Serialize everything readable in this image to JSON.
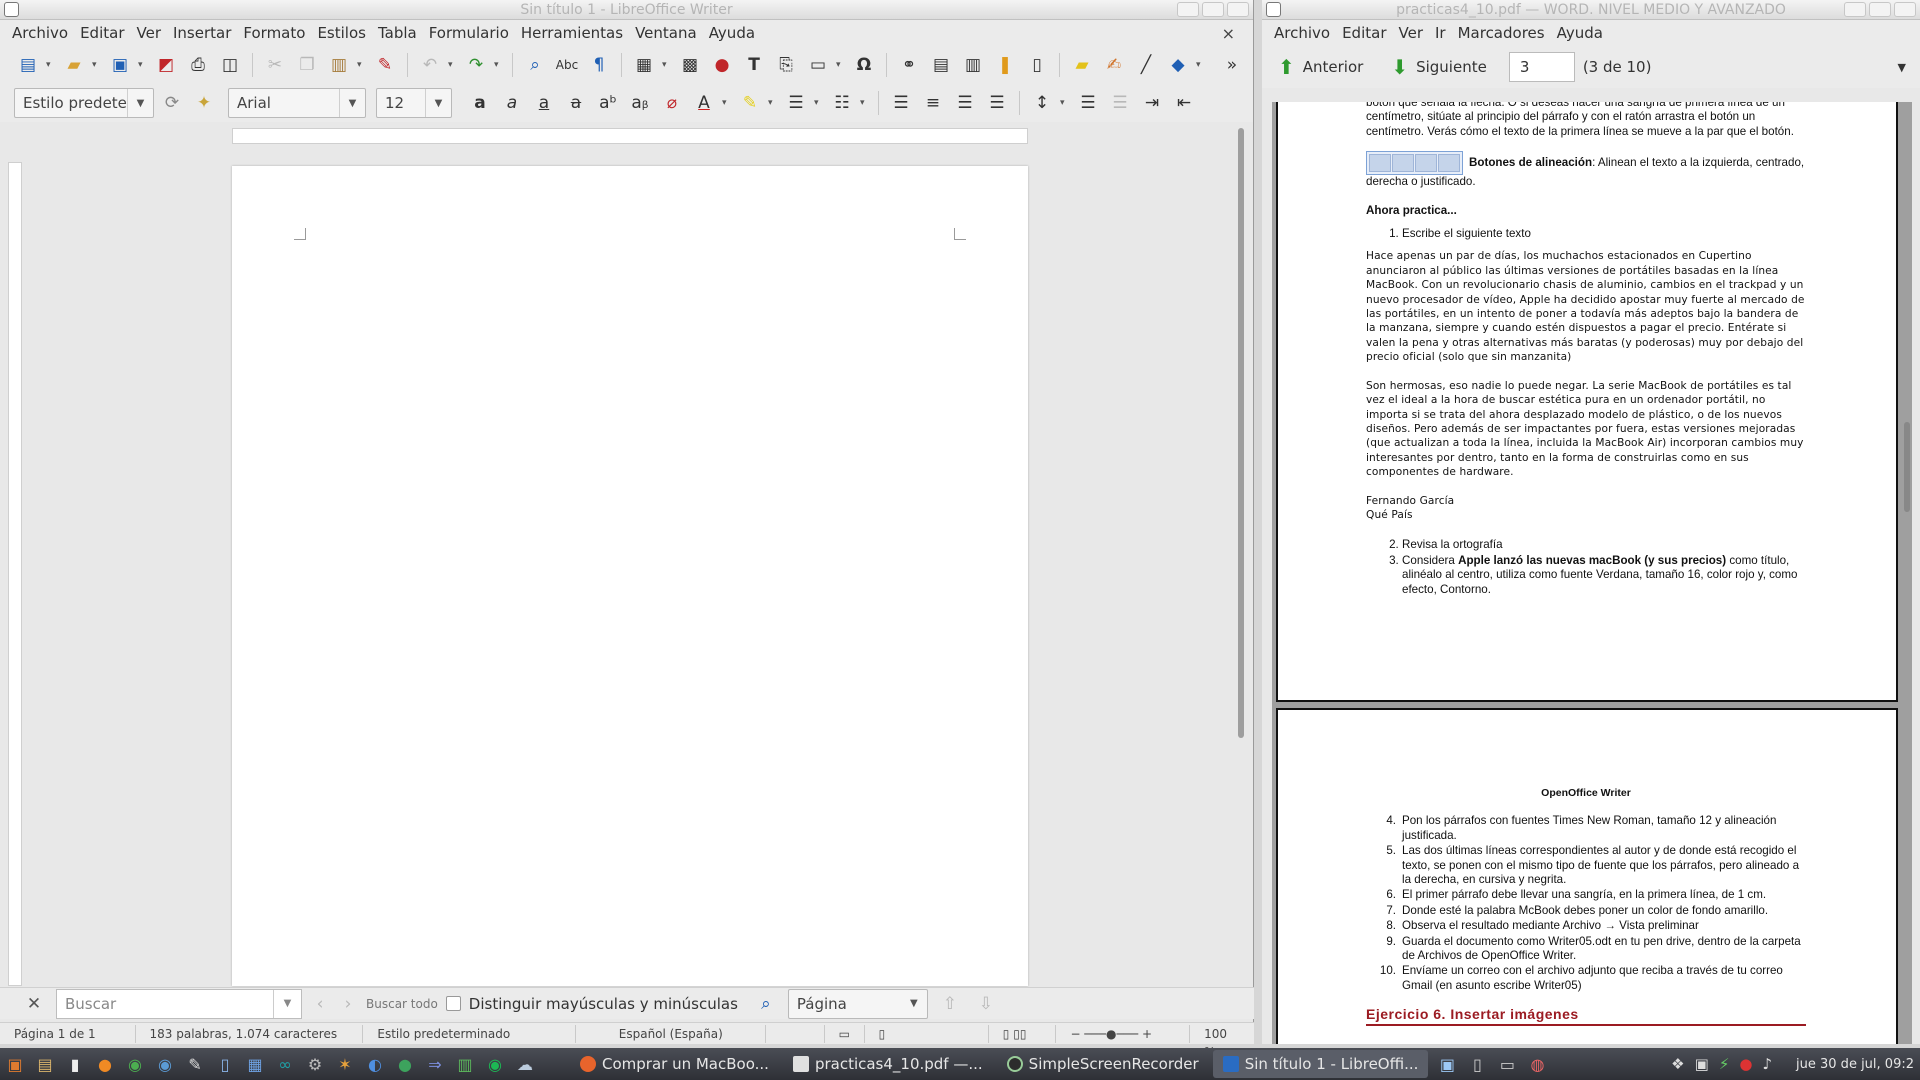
{
  "libreoffice": {
    "title": "Sin título 1 - LibreOffice Writer",
    "menu": [
      "Archivo",
      "Editar",
      "Ver",
      "Insertar",
      "Formato",
      "Estilos",
      "Tabla",
      "Formulario",
      "Herramientas",
      "Ventana",
      "Ayuda"
    ],
    "close_glyph": "×",
    "style_value": "Estilo predete",
    "font_value": "Arial",
    "size_value": "12",
    "find": {
      "placeholder": "Buscar",
      "find_all": "Buscar todo",
      "match_case": "Distinguir mayúsculas y minúsculas",
      "scope": "Página"
    },
    "status": {
      "page": "Página 1 de 1",
      "words": "183 palabras, 1.074 caracteres",
      "style": "Estilo predeterminado",
      "language": "Español (España)",
      "zoom": "100 %"
    }
  },
  "pdf": {
    "title": "practicas4_10.pdf — WORD. NIVEL MEDIO Y AVANZADO",
    "menu": [
      "Archivo",
      "Editar",
      "Ver",
      "Ir",
      "Marcadores",
      "Ayuda"
    ],
    "prev_label": "Anterior",
    "next_label": "Siguiente",
    "page_value": "3",
    "page_count": "(3 de 10)",
    "top_text": "botón que señala la flecha. O si deseas hacer una sangría de primera línea de un centímetro, sitúate al principio del párrafo y con el ratón arrastra el botón un centímetro. Verás cómo el texto de la primera línea se mueve a la par que el botón.",
    "align_label": "Botones de alineación",
    "align_text": ": Alinean el texto a la izquierda, centrado, derecha o justificado.",
    "practice_heading": "Ahora practica...",
    "step1": "Escribe el siguiente texto",
    "para1": "Hace apenas un par de días, los muchachos estacionados en Cupertino anunciaron al público las últimas versiones de portátiles basadas en la línea MacBook. Con un revolucionario chasis de aluminio, cambios en el trackpad y un nuevo procesador de vídeo, Apple ha decidido apostar muy fuerte al mercado de las portátiles, en un intento de poner a todavía más adeptos bajo la bandera de la manzana, siempre y cuando estén dispuestos a pagar el precio. Entérate si valen la pena y otras alternativas más baratas (y poderosas) muy por debajo del precio oficial (solo que sin manzanita)",
    "para2": "Son hermosas, eso nadie lo puede negar. La serie MacBook de portátiles es tal vez el ideal a la hora de buscar estética pura en un ordenador portátil, no importa si se trata del ahora desplazado modelo de plástico, o de los nuevos diseños. Pero además de ser impactantes por fuera, estas versiones mejoradas (que actualizan a toda la línea, incluida la MacBook Air) incorporan cambios muy interesantes por dentro, tanto en la forma de construirlas como en sus componentes de hardware.",
    "author": "Fernando García",
    "source": "Qué País",
    "step2": "Revisa la ortografía",
    "step3_pre": "Considera ",
    "step3_bold": "Apple lanzó las nuevas macBook (y sus precios)",
    "step3_post": " como título, alinéalo al centro, utiliza como fuente Verdana, tamaño 16, color rojo y, como efecto, Contorno.",
    "page2_header": "OpenOffice Writer",
    "steps_page2": [
      {
        "n": "4.",
        "t": "Pon los párrafos con fuentes Times New Roman, tamaño 12 y alineación justificada."
      },
      {
        "n": "5.",
        "t": "Las dos últimas líneas correspondientes al autor y de donde está recogido el texto, se ponen con el mismo tipo de fuente que los párrafos, pero alineado a la derecha, en cursiva y negrita."
      },
      {
        "n": "6.",
        "t": "El primer párrafo debe llevar una sangría, en la primera línea, de 1 cm."
      },
      {
        "n": "7.",
        "t": "Donde esté la palabra McBook debes poner un color de fondo amarillo."
      },
      {
        "n": "8.",
        "t": "Observa el resultado mediante Archivo → Vista preliminar"
      },
      {
        "n": "9.",
        "t": "Guarda el documento como Writer05.odt en tu pen drive, dentro de la carpeta de Archivos de OpenOffice Writer."
      },
      {
        "n": "10.",
        "t": "Envíame un correo con el archivo adjunto que reciba a través de tu correo Gmail (en asunto escribe Writer05)"
      }
    ],
    "exercise_heading": "Ejercicio 6. Insertar imágenes"
  },
  "taskbar": {
    "tasks": [
      {
        "label": "Comprar un MacBoo...",
        "color": "#e8642c"
      },
      {
        "label": "practicas4_10.pdf —...",
        "color": "#e0e0e0"
      },
      {
        "label": "SimpleScreenRecorder",
        "color": "#3a3a3a"
      },
      {
        "label": "Sin título 1 - LibreOffi...",
        "color": "#2a6cc2"
      }
    ],
    "clock": "jue 30 de jul, 09:2"
  }
}
